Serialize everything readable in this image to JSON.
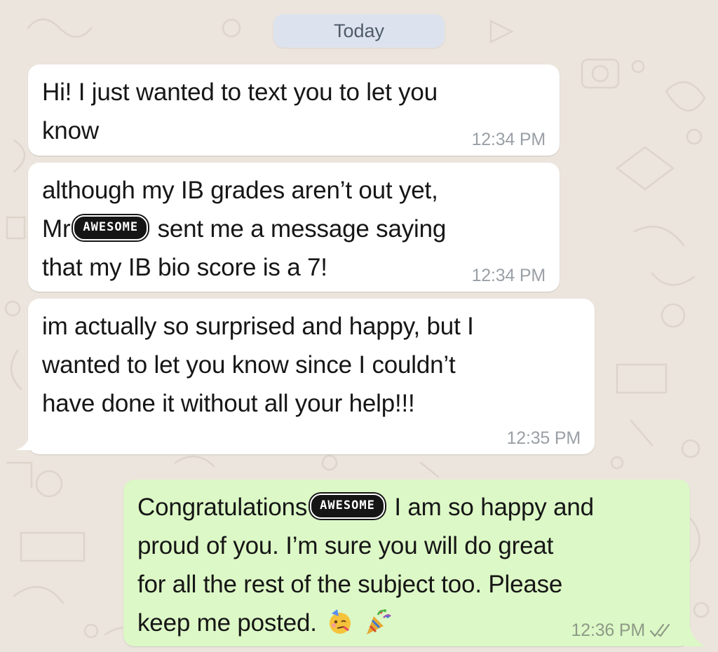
{
  "date_chip": {
    "label": "Today"
  },
  "messages": [
    {
      "direction": "incoming",
      "lines": [
        "Hi! I just wanted to text you to let you",
        "know"
      ],
      "time": "12:34 PM"
    },
    {
      "direction": "incoming",
      "line1": "although my IB grades aren’t out yet,",
      "line2_prefix": "Mr",
      "sticker": "AWESOME",
      "line2_suffix": " sent me a message saying",
      "line3": "that my IB bio score is a 7!",
      "time": "12:34 PM"
    },
    {
      "direction": "incoming",
      "lines": [
        "im actually so surprised and happy, but I",
        "wanted to let you know since I couldn’t",
        "have done it without all your help!!!"
      ],
      "time": "12:35 PM"
    },
    {
      "direction": "outgoing",
      "line1_prefix": "Congratulations",
      "sticker": "AWESOME",
      "line1_suffix": " I am so happy and",
      "line2": "proud of you. I’m sure you will do great",
      "line3": "for all the rest of the subject too. Please",
      "line4": "keep me posted.",
      "emojis": [
        "partying-face-emoji",
        "party-popper-emoji"
      ],
      "time": "12:36 PM",
      "status": "double-check-read-icon"
    }
  ],
  "colors": {
    "wallpaper": "#ece5dd",
    "incoming_bubble": "#ffffff",
    "outgoing_bubble": "#dcf8c6",
    "date_chip": "#dde3ee",
    "timestamp": "#9aa0a6"
  }
}
